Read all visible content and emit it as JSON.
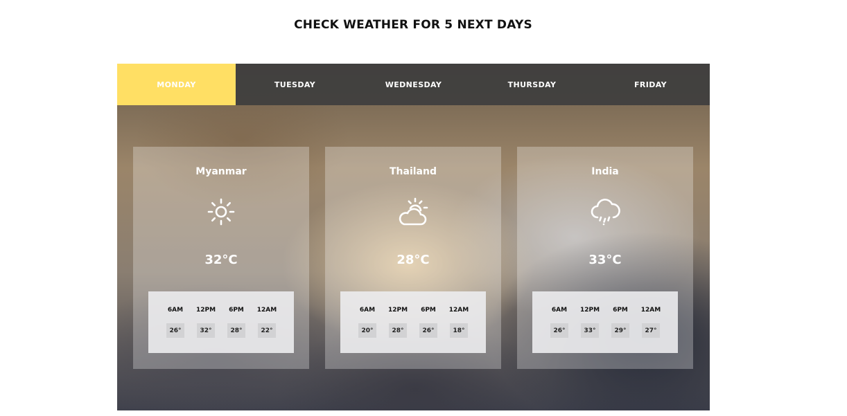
{
  "page": {
    "title": "CHECK WEATHER FOR 5 NEXT DAYS"
  },
  "tabs": [
    {
      "label": "MONDAY",
      "active": true
    },
    {
      "label": "TUESDAY",
      "active": false
    },
    {
      "label": "WEDNESDAY",
      "active": false
    },
    {
      "label": "THURSDAY",
      "active": false
    },
    {
      "label": "FRIDAY",
      "active": false
    }
  ],
  "colors": {
    "active_tab": "#ffdf64",
    "tab_bar": "#3e3e3e"
  },
  "cards": [
    {
      "city": "Myanmar",
      "icon": "sun-icon",
      "temp": "32°C",
      "hours": [
        {
          "time": "6AM",
          "temp": "26°"
        },
        {
          "time": "12PM",
          "temp": "32°"
        },
        {
          "time": "6PM",
          "temp": "28°"
        },
        {
          "time": "12AM",
          "temp": "22°"
        }
      ]
    },
    {
      "city": "Thailand",
      "icon": "partly-cloudy-icon",
      "temp": "28°C",
      "hours": [
        {
          "time": "6AM",
          "temp": "20°"
        },
        {
          "time": "12PM",
          "temp": "28°"
        },
        {
          "time": "6PM",
          "temp": "26°"
        },
        {
          "time": "12AM",
          "temp": "18°"
        }
      ]
    },
    {
      "city": "India",
      "icon": "rain-cloud-icon",
      "temp": "33°C",
      "hours": [
        {
          "time": "6AM",
          "temp": "26°"
        },
        {
          "time": "12PM",
          "temp": "33°"
        },
        {
          "time": "6PM",
          "temp": "29°"
        },
        {
          "time": "12AM",
          "temp": "27°"
        }
      ]
    }
  ]
}
